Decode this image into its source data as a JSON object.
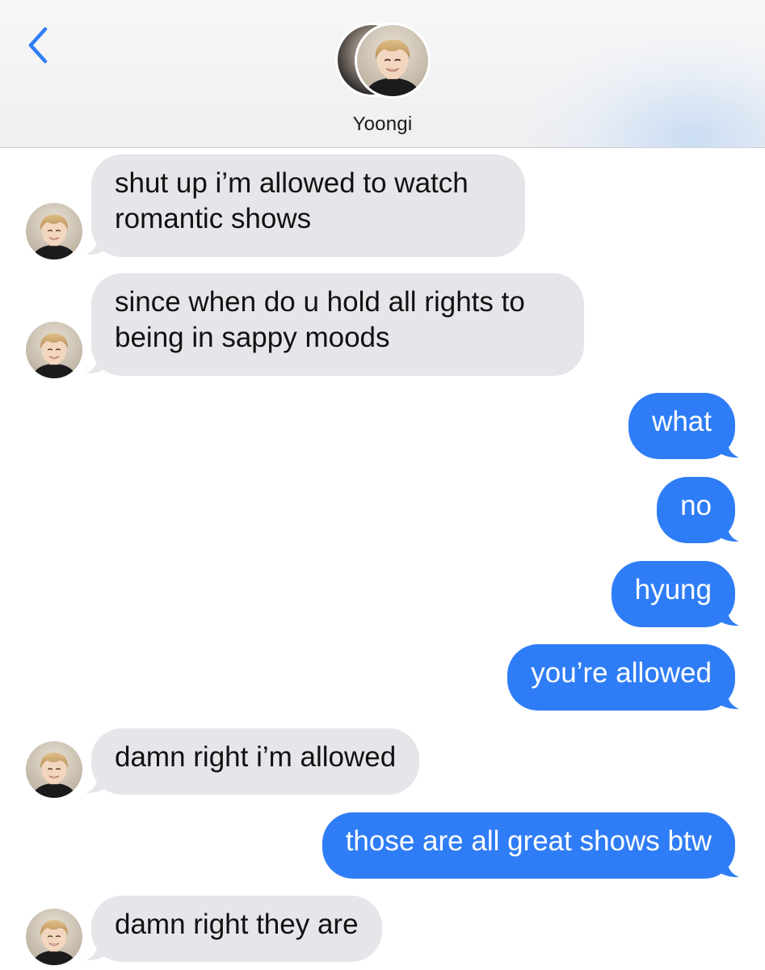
{
  "header": {
    "contact_name": "Yoongi"
  },
  "colors": {
    "incoming_bubble": "#e6e5ea",
    "outgoing_bubble": "#2f7df6",
    "accent": "#2f7df6"
  },
  "icons": {
    "back": "chevron-left-icon",
    "avatar": "contact-avatar"
  },
  "messages": [
    {
      "direction": "incoming",
      "lines": [
        "shut up i’m allowed to watch",
        "romantic shows"
      ]
    },
    {
      "direction": "incoming",
      "lines": [
        "since when do u hold all rights to",
        "being in sappy moods"
      ]
    },
    {
      "direction": "outgoing",
      "lines": [
        "what"
      ]
    },
    {
      "direction": "outgoing",
      "lines": [
        "no"
      ]
    },
    {
      "direction": "outgoing",
      "lines": [
        "hyung"
      ]
    },
    {
      "direction": "outgoing",
      "lines": [
        "you’re allowed"
      ]
    },
    {
      "direction": "incoming",
      "lines": [
        "damn right i’m allowed"
      ]
    },
    {
      "direction": "outgoing",
      "lines": [
        "those are all great shows btw"
      ]
    },
    {
      "direction": "incoming",
      "lines": [
        "damn right they are"
      ]
    }
  ]
}
